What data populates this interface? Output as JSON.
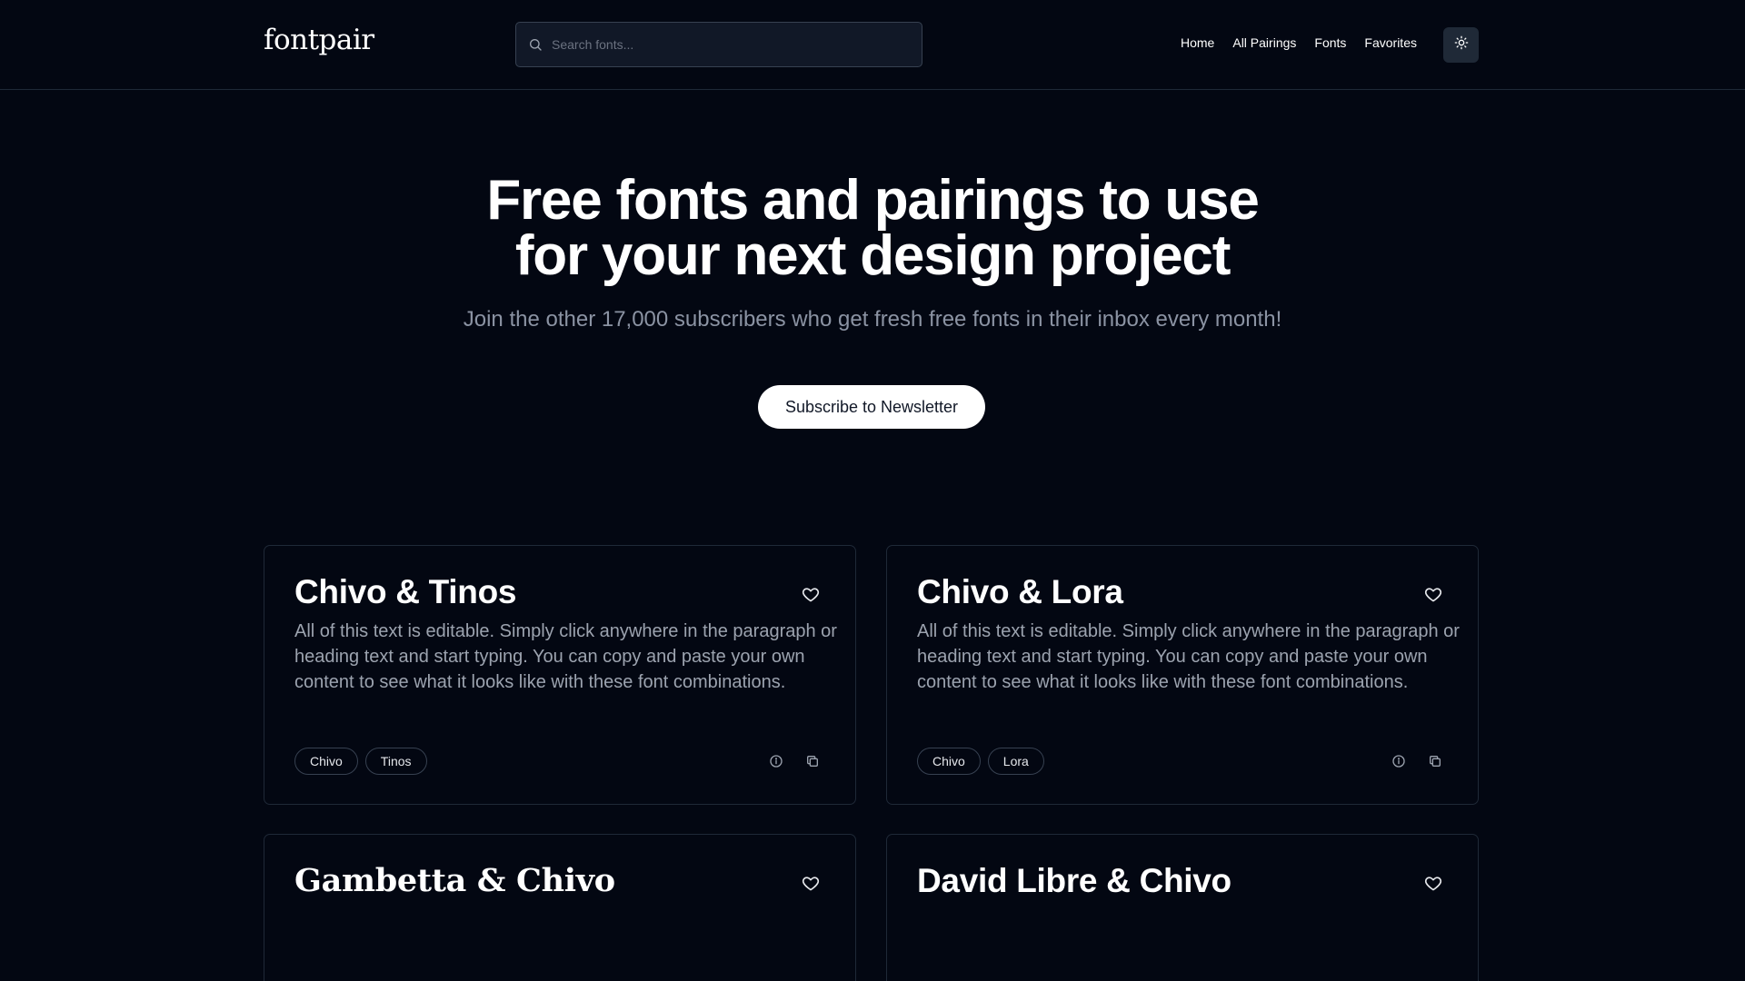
{
  "header": {
    "logo": "fontpair",
    "search_placeholder": "Search fonts...",
    "nav": [
      "Home",
      "All Pairings",
      "Fonts",
      "Favorites"
    ],
    "theme_toggle_icon": "sun-icon"
  },
  "hero": {
    "title": "Free fonts and pairings to use for your next design project",
    "subtitle": "Join the other 17,000 subscribers who get fresh free fonts in their inbox every month!",
    "cta": "Subscribe to Newsletter"
  },
  "cards": [
    {
      "title": "Chivo & Tinos",
      "body": "All of this text is editable. Simply click anywhere in the paragraph or heading text and start typing. You can copy and paste your own content to see what it looks like with these font combinations.",
      "tags": [
        "Chivo",
        "Tinos"
      ]
    },
    {
      "title": "Chivo & Lora",
      "body": "All of this text is editable. Simply click anywhere in the paragraph or heading text and start typing. You can copy and paste your own content to see what it looks like with these font combinations.",
      "tags": [
        "Chivo",
        "Lora"
      ]
    },
    {
      "title": "Gambetta & Chivo"
    },
    {
      "title": "David Libre & Chivo"
    }
  ],
  "colors": {
    "background": "#030712",
    "border": "#1f2937",
    "muted_text": "#9ca3af",
    "accent_button": "#ffffff"
  }
}
